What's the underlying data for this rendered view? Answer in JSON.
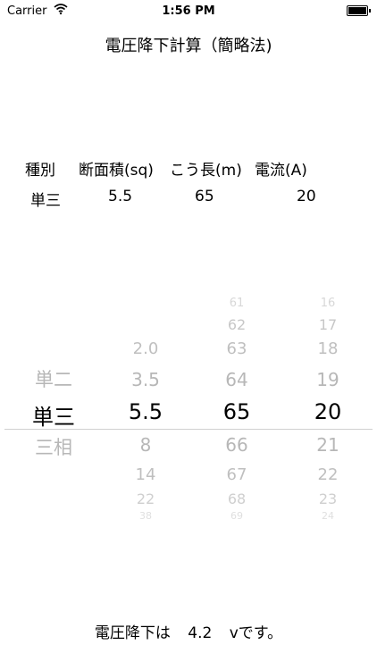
{
  "status_bar": {
    "carrier": "Carrier",
    "time": "1:56 PM",
    "wifi_icon": "wifi-icon",
    "battery_icon": "battery-icon"
  },
  "title": "電圧降下計算（簡略法)",
  "headers": {
    "type": "種別",
    "area": "断面積(sq)",
    "length": "こう長(m)",
    "current": "電流(A)"
  },
  "values": {
    "type": "単三",
    "area": "5.5",
    "length": "65",
    "current": "20"
  },
  "picker": {
    "type": [
      "単二",
      "単三",
      "三相"
    ],
    "area": [
      "2.0",
      "3.5",
      "5.5",
      "8",
      "14",
      "22",
      "38"
    ],
    "length": [
      "61",
      "62",
      "63",
      "64",
      "65",
      "66",
      "67",
      "68",
      "69"
    ],
    "current": [
      "16",
      "17",
      "18",
      "19",
      "20",
      "21",
      "22",
      "23",
      "24"
    ]
  },
  "result": {
    "prefix": "電圧降下は",
    "value": "4.2",
    "suffix": "vです。"
  }
}
